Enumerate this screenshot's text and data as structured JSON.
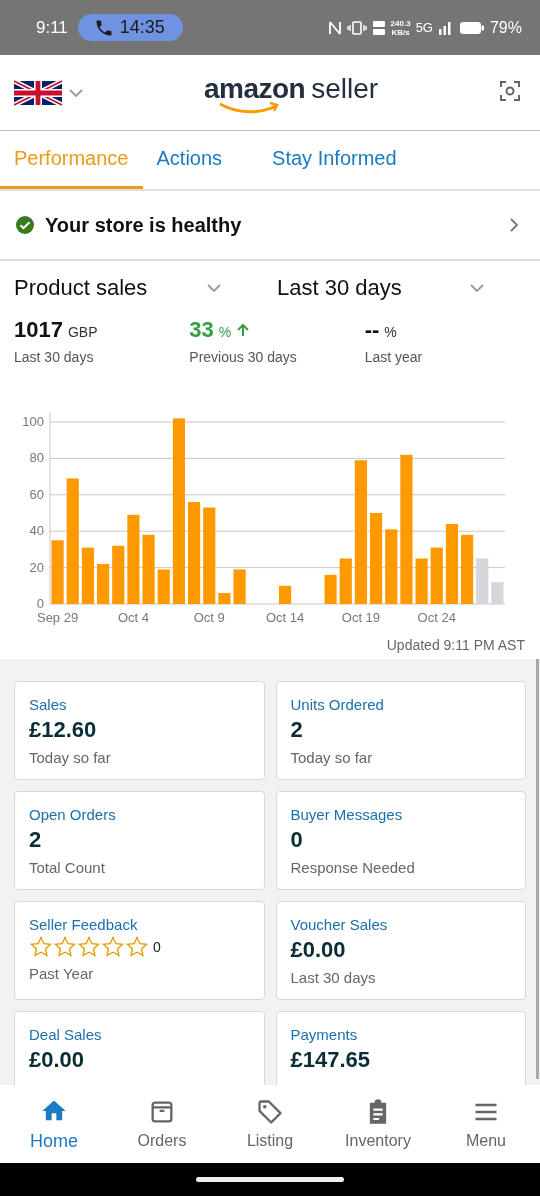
{
  "status_bar": {
    "time": "9:11",
    "call_timer": "14:35",
    "speed_value": "240.3",
    "speed_unit": "KB/s",
    "network": "5G",
    "battery": "79%"
  },
  "header": {
    "logo": {
      "brand": "amazon",
      "product": "seller"
    }
  },
  "tabs": [
    {
      "label": "Performance",
      "selected": true
    },
    {
      "label": "Actions",
      "selected": false
    },
    {
      "label": "Stay Informed",
      "selected": false
    }
  ],
  "health": {
    "text": "Your store is healthy",
    "healthy": true
  },
  "selectors": [
    {
      "label": "Product sales"
    },
    {
      "label": "Last 30 days"
    }
  ],
  "stats": [
    {
      "value": "1017",
      "unit": "GBP",
      "caption": "Last 30 days",
      "kind": "plain"
    },
    {
      "value": "33",
      "unit": "%",
      "caption": "Previous 30 days",
      "kind": "up"
    },
    {
      "value": "--",
      "unit": "%",
      "caption": "Last year",
      "kind": "plain"
    }
  ],
  "chart": {
    "chart_data": {
      "type": "bar",
      "categories": [
        "Sep 29",
        null,
        null,
        null,
        null,
        "Oct 4",
        null,
        null,
        null,
        null,
        "Oct 9",
        null,
        null,
        null,
        null,
        "Oct 14",
        null,
        null,
        null,
        null,
        "Oct 19",
        null,
        null,
        null,
        null,
        "Oct 24",
        null,
        null,
        null,
        null
      ],
      "grid": true,
      "series": [
        {
          "color": "#ff9900",
          "values": [
            35,
            69,
            31,
            22,
            32,
            49,
            38,
            19,
            102,
            56,
            53,
            6,
            19,
            0,
            0,
            10,
            0,
            0,
            16,
            25,
            79,
            50,
            41,
            82,
            25,
            31,
            44,
            38,
            null,
            null
          ]
        },
        {
          "color": "#d5d6d9",
          "values": [
            null,
            null,
            null,
            null,
            null,
            null,
            null,
            null,
            null,
            null,
            null,
            null,
            null,
            null,
            null,
            null,
            null,
            null,
            null,
            null,
            null,
            null,
            null,
            null,
            null,
            null,
            null,
            null,
            25,
            12
          ]
        }
      ],
      "ylim": [
        0,
        105
      ],
      "yticks": [
        0,
        20,
        40,
        60,
        80,
        100
      ]
    },
    "updated": "Updated 9:11 PM AST"
  },
  "cards": [
    {
      "title": "Sales",
      "value": "£12.60",
      "caption": "Today so far",
      "kind": "value"
    },
    {
      "title": "Units Ordered",
      "value": "2",
      "caption": "Today so far",
      "kind": "value"
    },
    {
      "title": "Open Orders",
      "value": "2",
      "caption": "Total Count",
      "kind": "value"
    },
    {
      "title": "Buyer Messages",
      "value": "0",
      "caption": "Response Needed",
      "kind": "value"
    },
    {
      "title": "Seller Feedback",
      "stars": 0,
      "value": "0",
      "caption": "Past Year",
      "kind": "rating"
    },
    {
      "title": "Voucher Sales",
      "value": "£0.00",
      "caption": "Last 30 days",
      "kind": "value"
    },
    {
      "title": "Deal Sales",
      "value": "£0.00",
      "kind": "value"
    },
    {
      "title": "Payments",
      "value": "£147.65",
      "kind": "value"
    }
  ],
  "bottom_nav": [
    {
      "label": "Home",
      "kind": "home",
      "selected": true
    },
    {
      "label": "Orders",
      "kind": "orders",
      "selected": false
    },
    {
      "label": "Listing",
      "kind": "listing",
      "selected": false
    },
    {
      "label": "Inventory",
      "kind": "inventory",
      "selected": false
    },
    {
      "label": "Menu",
      "kind": "menu",
      "selected": false
    }
  ]
}
